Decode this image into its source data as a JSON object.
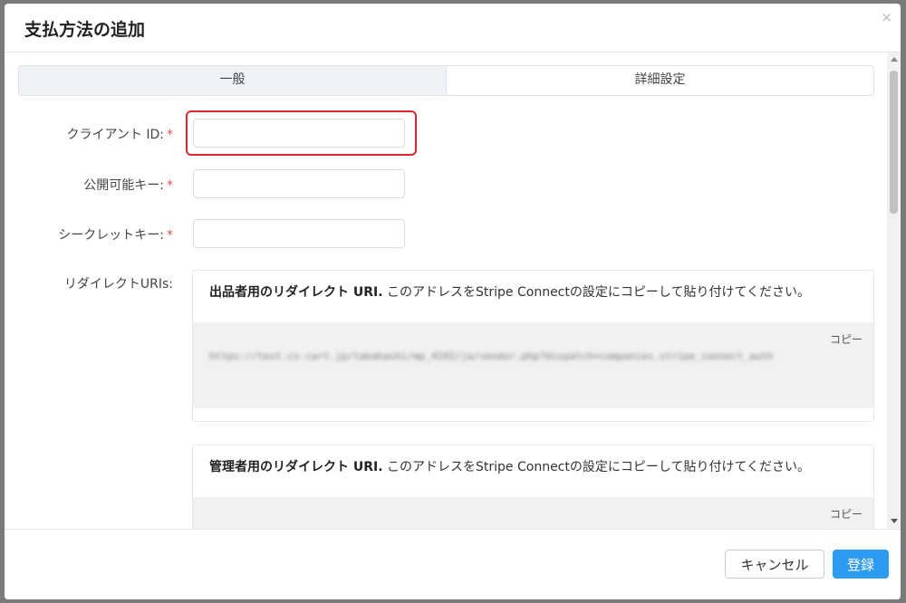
{
  "dialog": {
    "title": "支払方法の追加",
    "close_glyph": "×"
  },
  "tabs": [
    {
      "label": "一般",
      "active": false
    },
    {
      "label": "詳細設定",
      "active": true
    }
  ],
  "fields": {
    "client_id": {
      "label": "クライアント ID:",
      "required_mark": "*",
      "value": ""
    },
    "publishable_key": {
      "label": "公開可能キー:",
      "required_mark": "*",
      "value": ""
    },
    "secret_key": {
      "label": "シークレットキー:",
      "required_mark": "*",
      "value": ""
    },
    "redirect_uris_label": "リダイレクトURIs:"
  },
  "redirects": [
    {
      "title": "出品者用のリダイレクト URI.",
      "description": " このアドレスをStripe Connectの設定にコピーして貼り付けてください。",
      "copy_label": "コピー",
      "url": "https://test.cs-cart.jp/takahashi/mp_4102/ja/vendor.php?dispatch=companies.stripe_connect_auth"
    },
    {
      "title": "管理者用のリダイレクト URI.",
      "description": " このアドレスをStripe Connectの設定にコピーして貼り付けてください。",
      "copy_label": "コピー",
      "url": ""
    }
  ],
  "footer": {
    "cancel_label": "キャンセル",
    "save_label": "登録"
  },
  "colors": {
    "primary": "#2d9cf0",
    "required": "#d9534f",
    "highlight": "#e0262b"
  }
}
